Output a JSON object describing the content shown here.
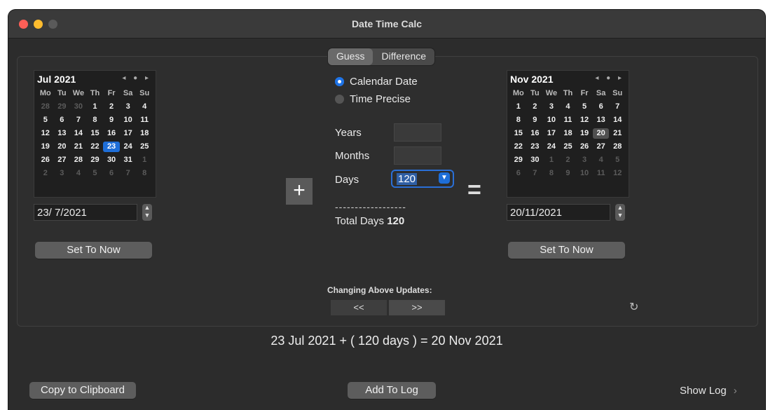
{
  "window": {
    "title": "Date Time Calc"
  },
  "tabs": [
    {
      "label": "Guess",
      "active": true
    },
    {
      "label": "Difference",
      "active": false
    }
  ],
  "left_calendar": {
    "month_label": "Jul 2021",
    "nav": "◂ ● ▸",
    "weekdays": [
      "Mo",
      "Tu",
      "We",
      "Th",
      "Fr",
      "Sa",
      "Su"
    ],
    "days": [
      [
        "28",
        "29",
        "30",
        "1",
        "2",
        "3",
        "4"
      ],
      [
        "5",
        "6",
        "7",
        "8",
        "9",
        "10",
        "11"
      ],
      [
        "12",
        "13",
        "14",
        "15",
        "16",
        "17",
        "18"
      ],
      [
        "19",
        "20",
        "21",
        "22",
        "23",
        "24",
        "25"
      ],
      [
        "26",
        "27",
        "28",
        "29",
        "30",
        "31",
        "1"
      ],
      [
        "2",
        "3",
        "4",
        "5",
        "6",
        "7",
        "8"
      ]
    ],
    "selected_day": "23",
    "date_value": "23/ 7/2021",
    "set_now_label": "Set To Now"
  },
  "right_calendar": {
    "month_label": "Nov 2021",
    "nav": "◂ ● ▸",
    "weekdays": [
      "Mo",
      "Tu",
      "We",
      "Th",
      "Fr",
      "Sa",
      "Su"
    ],
    "days": [
      [
        "1",
        "2",
        "3",
        "4",
        "5",
        "6",
        "7"
      ],
      [
        "8",
        "9",
        "10",
        "11",
        "12",
        "13",
        "14"
      ],
      [
        "15",
        "16",
        "17",
        "18",
        "19",
        "20",
        "21"
      ],
      [
        "22",
        "23",
        "24",
        "25",
        "26",
        "27",
        "28"
      ],
      [
        "29",
        "30",
        "1",
        "2",
        "3",
        "4",
        "5"
      ],
      [
        "6",
        "7",
        "8",
        "9",
        "10",
        "11",
        "12"
      ]
    ],
    "selected_day": "20",
    "date_value": "20/11/2021",
    "set_now_label": "Set To Now"
  },
  "mode": {
    "options": [
      {
        "label": "Calendar Date",
        "selected": true
      },
      {
        "label": "Time Precise",
        "selected": false
      }
    ]
  },
  "inputs": {
    "years_label": "Years",
    "months_label": "Months",
    "days_label": "Days",
    "days_value": "120",
    "dashes": "------------------",
    "total_label": "Total Days",
    "total_value": "120"
  },
  "operators": {
    "plus": "+",
    "equals": "="
  },
  "updates": {
    "label": "Changing Above Updates:",
    "back": "<<",
    "forward": ">>"
  },
  "result_text": "23 Jul 2021 + ( 120 days ) = 20 Nov 2021",
  "footer": {
    "copy_label": "Copy to Clipboard",
    "add_log_label": "Add To Log",
    "show_log_label": "Show Log",
    "show_log_chevron": "›"
  },
  "colors": {
    "accent": "#1e6ed8",
    "window_bg": "#2c2c2c"
  }
}
